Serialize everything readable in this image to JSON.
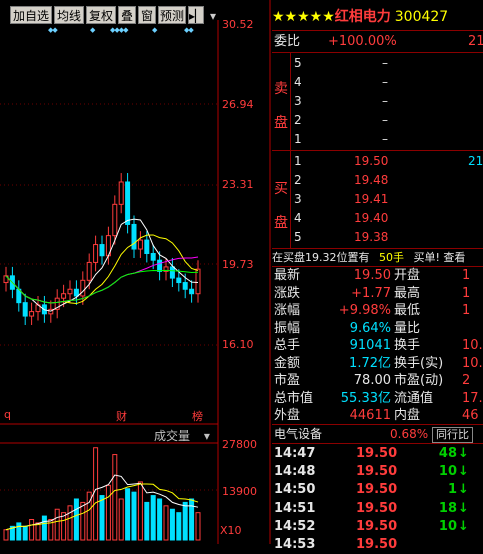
{
  "toolbar": {
    "buttons": [
      "加自选",
      "均线",
      "复权",
      "叠",
      "窗",
      "预测"
    ],
    "nav_icon": "▸▏",
    "dropdown_icon": "▾",
    "event_marks": [
      "◆◆",
      "◆",
      "◆◆◆◆",
      "◆",
      "◆◆"
    ]
  },
  "price_axis": {
    "ticks": [
      "30.52",
      "26.94",
      "23.31",
      "19.73",
      "16.10"
    ]
  },
  "kline_labels": {
    "left_mark": "q",
    "mid_mark": "财",
    "right_mark": "榜"
  },
  "volume": {
    "indicator_label": "成交量",
    "ticks": [
      "27800",
      "13900"
    ],
    "unit": "X10",
    "bars": [
      3,
      4,
      5,
      4,
      6,
      5,
      7,
      6,
      9,
      8,
      10,
      12,
      11,
      14,
      27,
      13,
      16,
      25,
      12,
      15,
      14,
      17,
      11,
      13,
      12,
      10,
      9,
      8,
      11,
      12,
      8
    ]
  },
  "stock": {
    "stars": "★★★★★",
    "name": "红相电力",
    "code": "300427"
  },
  "quote": {
    "weibi_label": "委比",
    "weibi_value": "+100.00%",
    "weibi_right": "21",
    "sell_side": "卖盘",
    "buy_side": "买盘",
    "sell_levels": [
      {
        "level": "5",
        "price": "–"
      },
      {
        "level": "4",
        "price": "–"
      },
      {
        "level": "3",
        "price": "–"
      },
      {
        "level": "2",
        "price": "–"
      },
      {
        "level": "1",
        "price": "–"
      }
    ],
    "buy_levels": [
      {
        "level": "1",
        "price": "19.50",
        "vol": "21"
      },
      {
        "level": "2",
        "price": "19.48",
        "vol": ""
      },
      {
        "level": "3",
        "price": "19.41",
        "vol": ""
      },
      {
        "level": "4",
        "price": "19.40",
        "vol": ""
      },
      {
        "level": "5",
        "price": "19.38",
        "vol": ""
      }
    ],
    "buy_notice": "在买盘19.32位置有",
    "buy_notice_vol": "50手",
    "buy_notice_tail": "买单! 查看",
    "stats": [
      {
        "l1": "最新",
        "v1": "19.50",
        "l2": "开盘",
        "v2": "1"
      },
      {
        "l1": "涨跌",
        "v1": "+1.77",
        "l2": "最高",
        "v2": "1"
      },
      {
        "l1": "涨幅",
        "v1": "+9.98%",
        "l2": "最低",
        "v2": "1"
      },
      {
        "l1": "振幅",
        "v1": "9.64%",
        "l2": "量比",
        "v2": ""
      },
      {
        "l1": "总手",
        "v1": "91041",
        "l2": "换手",
        "v2": "10."
      },
      {
        "l1": "金额",
        "v1": "1.72亿",
        "l2": "换手(实)",
        "v2": "10."
      },
      {
        "l1": "市盈",
        "v1": "78.00",
        "l2": "市盈(动)",
        "v2": "2"
      },
      {
        "l1": "总市值",
        "v1": "55.33亿",
        "l2": "流通值",
        "v2": "17.1"
      },
      {
        "l1": "外盘",
        "v1": "44611",
        "l2": "内盘",
        "v2": "46"
      }
    ],
    "sector_name": "电气设备",
    "sector_change": "0.68%",
    "sector_tab": "同行比"
  },
  "trades": [
    {
      "time": "14:47",
      "price": "19.50",
      "vol": "48",
      "dir": "↓"
    },
    {
      "time": "14:48",
      "price": "19.50",
      "vol": "10",
      "dir": "↓"
    },
    {
      "time": "14:50",
      "price": "19.50",
      "vol": "1",
      "dir": "↓"
    },
    {
      "time": "14:51",
      "price": "19.50",
      "vol": "18",
      "dir": "↓"
    },
    {
      "time": "14:52",
      "price": "19.50",
      "vol": "10",
      "dir": "↓"
    },
    {
      "time": "14:53",
      "price": "19.50",
      "vol": "",
      "dir": ""
    }
  ],
  "colors": {
    "up": "#ff3c3c",
    "down": "#00e0ff",
    "ma1": "#ffffff",
    "ma2": "#ffff00",
    "ma3": "#ff00ff",
    "ma4": "#00ff00"
  }
}
